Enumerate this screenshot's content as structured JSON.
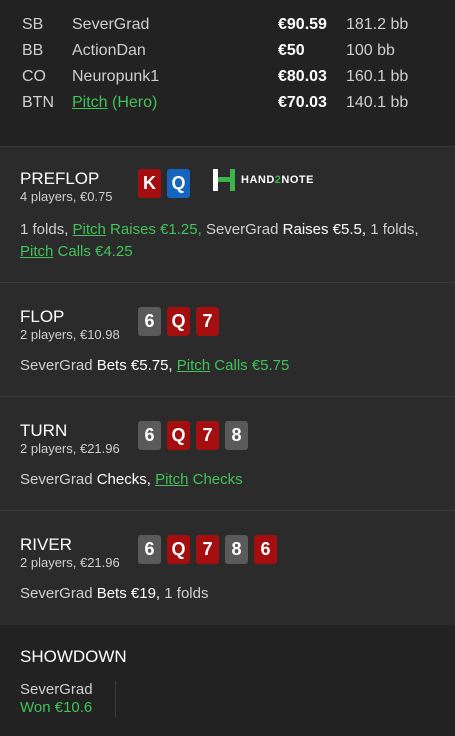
{
  "players": [
    {
      "pos": "SB",
      "name": "SeverGrad",
      "hero_suffix": "",
      "stack": "€90.59",
      "bb": "181.2 bb"
    },
    {
      "pos": "BB",
      "name": "ActionDan",
      "hero_suffix": "",
      "stack": "€50",
      "bb": "100 bb"
    },
    {
      "pos": "CO",
      "name": "Neuropunk1",
      "hero_suffix": "",
      "stack": "€80.03",
      "bb": "160.1 bb"
    },
    {
      "pos": "BTN",
      "name": "Pitch",
      "hero_suffix": " (Hero)",
      "stack": "€70.03",
      "bb": "140.1 bb"
    }
  ],
  "logo": {
    "text_a": "HAND",
    "text_b": "2",
    "text_c": "NOTE"
  },
  "preflop": {
    "title": "PREFLOP",
    "sub": "4 players, €0.75",
    "cards": [
      {
        "rank": "K",
        "color": "#a50e0e"
      },
      {
        "rank": "Q",
        "color": "#1565c0"
      }
    ],
    "actions": {
      "a1": "1 folds, ",
      "a2_name": "Pitch",
      "a2_verb": " Raises €1.25,",
      "a3_name": " SeverGrad",
      "a3_verb": " Raises €5.5,",
      "a4": " 1 folds,",
      "a5_name": "Pitch",
      "a5_verb": " Calls €4.25"
    }
  },
  "flop": {
    "title": "FLOP",
    "sub": "2 players, €10.98",
    "cards": [
      {
        "rank": "6",
        "color": "#5a5a5a"
      },
      {
        "rank": "Q",
        "color": "#a50e0e"
      },
      {
        "rank": "7",
        "color": "#a50e0e"
      }
    ],
    "actions": {
      "a1_name": "SeverGrad",
      "a1_verb": " Bets €5.75,",
      "a2_name": "Pitch",
      "a2_verb": " Calls €5.75"
    }
  },
  "turn": {
    "title": "TURN",
    "sub": "2 players, €21.96",
    "cards": [
      {
        "rank": "6",
        "color": "#5a5a5a"
      },
      {
        "rank": "Q",
        "color": "#a50e0e"
      },
      {
        "rank": "7",
        "color": "#a50e0e"
      },
      {
        "rank": "8",
        "color": "#5a5a5a"
      }
    ],
    "actions": {
      "a1_name": "SeverGrad",
      "a1_verb": " Checks,",
      "a2_name": "Pitch",
      "a2_verb": " Checks"
    }
  },
  "river": {
    "title": "RIVER",
    "sub": "2 players, €21.96",
    "cards": [
      {
        "rank": "6",
        "color": "#5a5a5a"
      },
      {
        "rank": "Q",
        "color": "#a50e0e"
      },
      {
        "rank": "7",
        "color": "#a50e0e"
      },
      {
        "rank": "8",
        "color": "#5a5a5a"
      },
      {
        "rank": "6",
        "color": "#a50e0e"
      }
    ],
    "actions": {
      "a1_name": "SeverGrad",
      "a1_verb": " Bets €19,",
      "a2": " 1 folds"
    }
  },
  "showdown": {
    "title": "SHOWDOWN",
    "player": "SeverGrad",
    "result": "Won €10.6"
  },
  "colors": {
    "hero": "#41c25a",
    "card_red": "#a50e0e",
    "card_blue": "#1565c0",
    "card_gray": "#5a5a5a"
  }
}
